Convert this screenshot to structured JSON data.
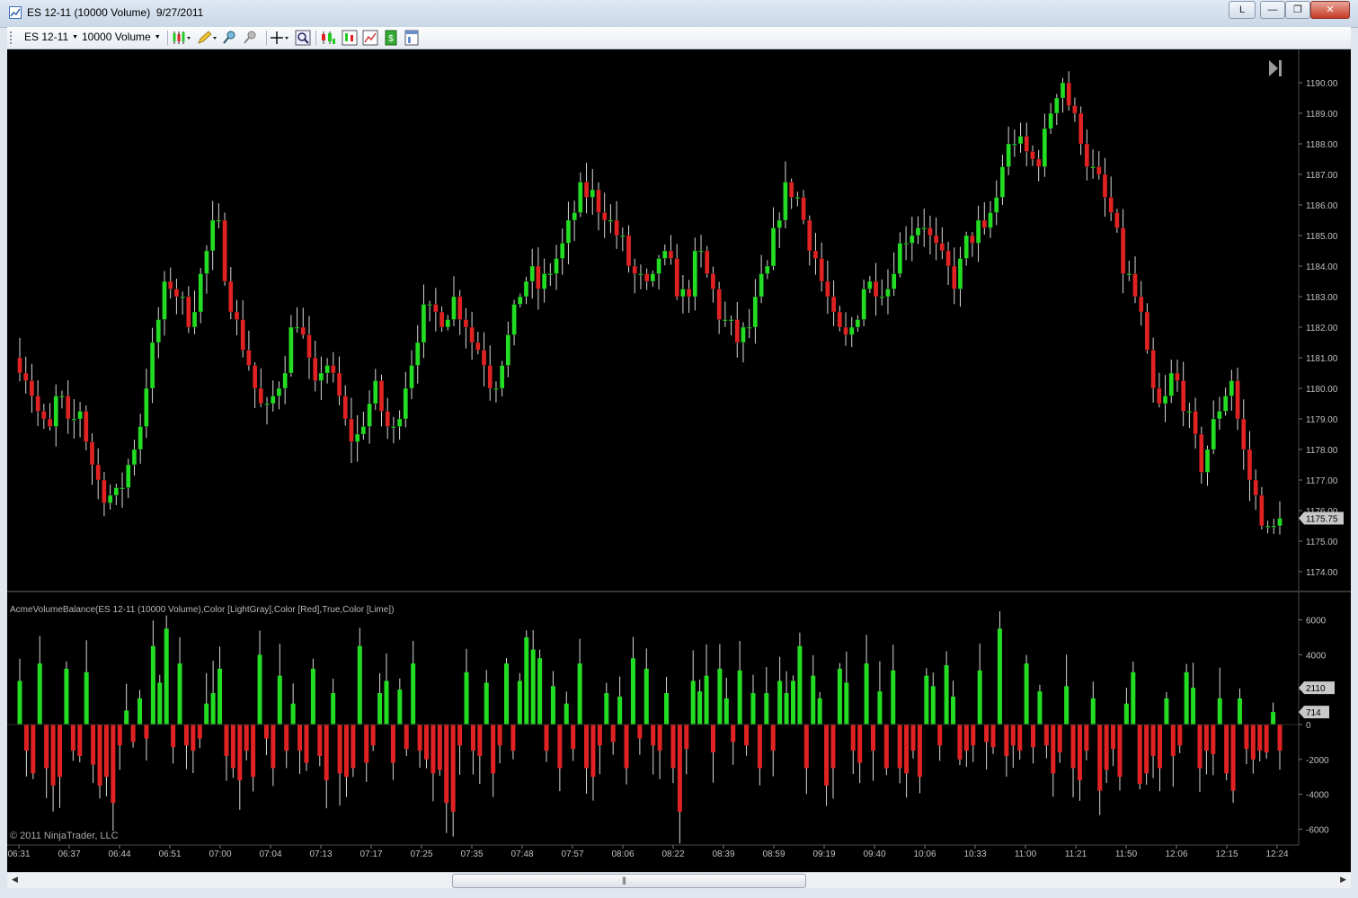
{
  "window": {
    "title": "ES 12-11 (10000 Volume)  9/27/2011",
    "buttons": {
      "l_label": "L",
      "minimize": "—",
      "restore": "❐",
      "close": "✕"
    }
  },
  "toolbar": {
    "instrument": "ES 12-11",
    "period": "10000 Volume"
  },
  "price_panel": {
    "axis_labels": [
      "1190.00",
      "1189.00",
      "1188.00",
      "1187.00",
      "1186.00",
      "1185.00",
      "1184.00",
      "1183.00",
      "1182.00",
      "1181.00",
      "1180.00",
      "1179.00",
      "1178.00",
      "1177.00",
      "1176.00",
      "1175.00",
      "1174.00"
    ],
    "last_price_label": "1175.75"
  },
  "indicator_panel": {
    "label": "AcmeVolumeBalance(ES 12-11 (10000 Volume),Color [LightGray],Color [Red],True,Color [Lime])",
    "axis_labels": [
      "6000",
      "4000",
      "2000",
      "0",
      "-2000",
      "-4000",
      "-6000"
    ],
    "marker_labels": [
      "2110",
      "714"
    ]
  },
  "copyright": "© 2011 NinjaTrader, LLC",
  "time_axis": [
    "06:31",
    "06:37",
    "06:44",
    "06:51",
    "07:00",
    "07:04",
    "07:13",
    "07:17",
    "07:25",
    "07:35",
    "07:48",
    "07:57",
    "08:06",
    "08:22",
    "08:39",
    "08:59",
    "09:19",
    "09:40",
    "10:06",
    "10:33",
    "11:00",
    "11:21",
    "11:50",
    "12:06",
    "12:15",
    "12:24"
  ],
  "colors": {
    "up": "#22dd22",
    "down": "#e02222",
    "wick": "#d8d8d8",
    "axis_text": "#c0c0c0",
    "background": "#000000"
  },
  "chart_data": {
    "type": "candlestick",
    "close_path": [
      1181.0,
      1180.0,
      1179.0,
      1178.5,
      1180.0,
      1178.5,
      1179.5,
      1178.0,
      1177.0,
      1176.5,
      1176.5,
      1177.5,
      1178.5,
      1180.5,
      1182.0,
      1183.5,
      1183.0,
      1182.3,
      1183.0,
      1184.5,
      1185.5,
      1183.5,
      1182.0,
      1181.0,
      1180.0,
      1179.0,
      1180.0,
      1181.0,
      1182.5,
      1181.3,
      1180.0,
      1181.0,
      1180.0,
      1179.0,
      1178.0,
      1179.0,
      1180.0,
      1179.0,
      1178.5,
      1180.0,
      1181.3,
      1182.3,
      1182.6,
      1182.3,
      1183.0,
      1182.5,
      1181.5,
      1181.0,
      1180.0,
      1181.0,
      1182.0,
      1183.5,
      1183.6,
      1183.3,
      1183.8,
      1184.5,
      1185.5,
      1186.5,
      1186.4,
      1186.0,
      1185.4,
      1185.0,
      1184.0,
      1183.5,
      1183.0,
      1184.5,
      1184.0,
      1183.0,
      1183.3,
      1184.5,
      1183.5,
      1182.5,
      1182.0,
      1181.5,
      1182.0,
      1183.0,
      1184.0,
      1185.8,
      1186.6,
      1186.2,
      1185.0,
      1184.0,
      1183.0,
      1181.8,
      1181.5,
      1182.5,
      1183.5,
      1183.5,
      1183.2,
      1184.5,
      1185.0,
      1185.4,
      1185.4,
      1184.5,
      1184.0,
      1183.5,
      1184.5,
      1185.3,
      1185.0,
      1186.0,
      1187.5,
      1188.2,
      1187.8,
      1187.3,
      1188.0,
      1189.5,
      1190.0,
      1189.0,
      1188.0,
      1187.0,
      1186.5,
      1185.5,
      1184.0,
      1183.5,
      1182.0,
      1180.0,
      1179.0,
      1180.5,
      1180.0,
      1178.5,
      1177.5,
      1178.5,
      1179.5,
      1180.5,
      1178.5,
      1177.0,
      1176.0,
      1175.0,
      1175.75
    ],
    "price_axis_range": [
      1173.5,
      1190.5
    ],
    "price_axis_ticks": [
      1190,
      1189,
      1188,
      1187,
      1186,
      1185,
      1184,
      1183,
      1182,
      1181,
      1180,
      1179,
      1178,
      1177,
      1176,
      1175,
      1174
    ],
    "last_price": 1175.75,
    "volume_balance_path": [
      2500,
      -1500,
      -2800,
      3500,
      -2500,
      -3500,
      -3000,
      3200,
      -1500,
      -1800,
      3000,
      -2300,
      -3500,
      -3000,
      -4500,
      -1200,
      800,
      -1000,
      1500,
      -800,
      4500,
      2400,
      5500,
      -1300,
      3500,
      -1200,
      -1500,
      -800,
      1200,
      1800,
      3200,
      -1800,
      -2500,
      -3200,
      -1500,
      -3000,
      4000,
      -800,
      -2500,
      2800,
      -1500,
      1200,
      -1500,
      -2200,
      3200,
      -1800,
      -3200,
      1800,
      -2800,
      -3000,
      -2500,
      4500,
      -2200,
      -1200,
      1800,
      2500,
      -2200,
      2000,
      -1400,
      3500,
      -1500,
      -2000,
      -2800,
      -2600,
      -4500,
      -5000,
      -1200,
      3000,
      -1500,
      -1800,
      2400,
      -2800,
      -1200,
      3500,
      -1500,
      2500,
      5000,
      4300,
      3800,
      -1500,
      2200,
      -2500,
      1200,
      -1400,
      3500,
      -2500,
      -3000,
      -1200,
      1800,
      -1000,
      1600,
      -2500,
      3800,
      -800,
      3200,
      -1200,
      -1500,
      1800,
      -2500,
      -5000,
      -1400,
      2500,
      1900,
      2800,
      -1600,
      3200,
      1500,
      -1000,
      3100,
      -1200,
      1800,
      -2500,
      1800,
      -1500,
      2500,
      1800,
      2500,
      4500,
      -2500,
      2800,
      1500,
      -3500,
      -2500,
      3200,
      2400,
      -1500,
      -2200,
      3500,
      -1500,
      1900,
      -2500,
      3100,
      -2500,
      -2800,
      -1500,
      -3000,
      2800,
      2200,
      -1200,
      3400,
      1600,
      -2000,
      -1500,
      -1200,
      3100,
      -1000,
      -1300,
      5500,
      -1800,
      -1200,
      -1500,
      3500,
      -1300,
      1900,
      -1200,
      -2800,
      -1600,
      2200,
      -2500,
      -3200,
      -1500,
      1500,
      -3800,
      -2600,
      -1400,
      -3000,
      1200,
      3000,
      -3400,
      -2800,
      -1800,
      -2500,
      1500,
      -1800,
      -1200,
      3000,
      2110,
      -2500,
      -1500,
      -1700,
      1500,
      -2800,
      -3800,
      1500,
      -1400,
      -2000,
      -1500,
      -1600,
      714,
      -1500
    ],
    "volume_axis_range": [
      -6500,
      6500
    ],
    "volume_axis_ticks": [
      6000,
      4000,
      2000,
      0,
      -2000,
      -4000,
      -6000
    ],
    "marker_values": [
      2110,
      714
    ]
  }
}
